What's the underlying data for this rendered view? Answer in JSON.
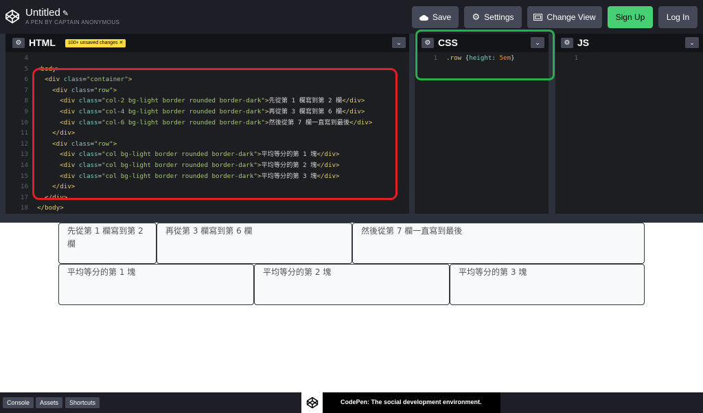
{
  "header": {
    "title": "Untitled",
    "subtitle": "A PEN BY CAPTAIN ANONYMOUS",
    "buttons": {
      "save": "Save",
      "settings": "Settings",
      "change_view": "Change View",
      "sign_up": "Sign Up",
      "log_in": "Log In"
    }
  },
  "html_panel": {
    "title": "HTML",
    "badge": "100+ unsaved changes",
    "lines": [
      {
        "n": "4",
        "html": ""
      },
      {
        "n": "5",
        "html": "<span class='t'>&lt;body&gt;</span>"
      },
      {
        "n": "6",
        "html": "  <span class='t'>&lt;div</span> <span class='a'>class</span>=<span class='s'>\"container\"</span><span class='t'>&gt;</span>"
      },
      {
        "n": "7",
        "html": "    <span class='t'>&lt;div</span> <span class='a'>class</span>=<span class='s'>\"row\"</span><span class='t'>&gt;</span>"
      },
      {
        "n": "8",
        "html": "      <span class='t'>&lt;div</span> <span class='a'>class</span>=<span class='s'>\"col-2 bg-light border rounded border-dark\"</span><span class='t'>&gt;</span>先從第 1 欄寫到第 2 欄<span class='t'>&lt;/div&gt;</span>"
      },
      {
        "n": "9",
        "html": "      <span class='t'>&lt;div</span> <span class='a'>class</span>=<span class='s'>\"col-4 bg-light border rounded border-dark\"</span><span class='t'>&gt;</span>再從第 3 欄寫到第 6 欄<span class='t'>&lt;/div&gt;</span>"
      },
      {
        "n": "10",
        "html": "      <span class='t'>&lt;div</span> <span class='a'>class</span>=<span class='s'>\"col-6 bg-light border rounded border-dark\"</span><span class='t'>&gt;</span>然後從第 7 欄一直寫到最後<span class='t'>&lt;/div&gt;</span>"
      },
      {
        "n": "11",
        "html": "    <span class='t'>&lt;/div&gt;</span>"
      },
      {
        "n": "12",
        "html": "    <span class='t'>&lt;div</span> <span class='a'>class</span>=<span class='s'>\"row\"</span><span class='t'>&gt;</span>"
      },
      {
        "n": "13",
        "html": "      <span class='t'>&lt;div</span> <span class='a'>class</span>=<span class='s'>\"col bg-light border rounded border-dark\"</span><span class='t'>&gt;</span>平均等分的第 1 塊<span class='t'>&lt;/div&gt;</span>"
      },
      {
        "n": "14",
        "html": "      <span class='t'>&lt;div</span> <span class='a'>class</span>=<span class='s'>\"col bg-light border rounded border-dark\"</span><span class='t'>&gt;</span>平均等分的第 2 塊<span class='t'>&lt;/div&gt;</span>"
      },
      {
        "n": "15",
        "html": "      <span class='t'>&lt;div</span> <span class='a'>class</span>=<span class='s'>\"col bg-light border rounded border-dark\"</span><span class='t'>&gt;</span>平均等分的第 3 塊<span class='t'>&lt;/div&gt;</span>"
      },
      {
        "n": "16",
        "html": "    <span class='t'>&lt;/div&gt;</span>"
      },
      {
        "n": "17",
        "html": "  <span class='t'>&lt;/div&gt;</span>"
      },
      {
        "n": "18",
        "html": "<span class='t'>&lt;/body&gt;</span>"
      }
    ]
  },
  "css_panel": {
    "title": "CSS",
    "lines": [
      {
        "n": "1",
        "html": "<span class='p'>.row</span> {<span class='a'>height</span>: <span class='n'>5em</span>}"
      }
    ]
  },
  "js_panel": {
    "title": "JS",
    "lines": [
      {
        "n": "1",
        "html": ""
      }
    ]
  },
  "preview": {
    "row1": [
      "先從第 1 欄寫到第 2 欄",
      "再從第 3 欄寫到第 6 欄",
      "然後從第 7 欄一直寫到最後"
    ],
    "row2": [
      "平均等分的第 1 塊",
      "平均等分的第 2 塊",
      "平均等分的第 3 塊"
    ]
  },
  "footer": {
    "console": "Console",
    "assets": "Assets",
    "shortcuts": "Shortcuts",
    "promo": "CodePen: The social development environment."
  },
  "colors": {
    "accent_green": "#47cf73",
    "badge_yellow": "#ffdd40",
    "highlight_red": "#e11d2a",
    "highlight_green": "#22b14c"
  }
}
